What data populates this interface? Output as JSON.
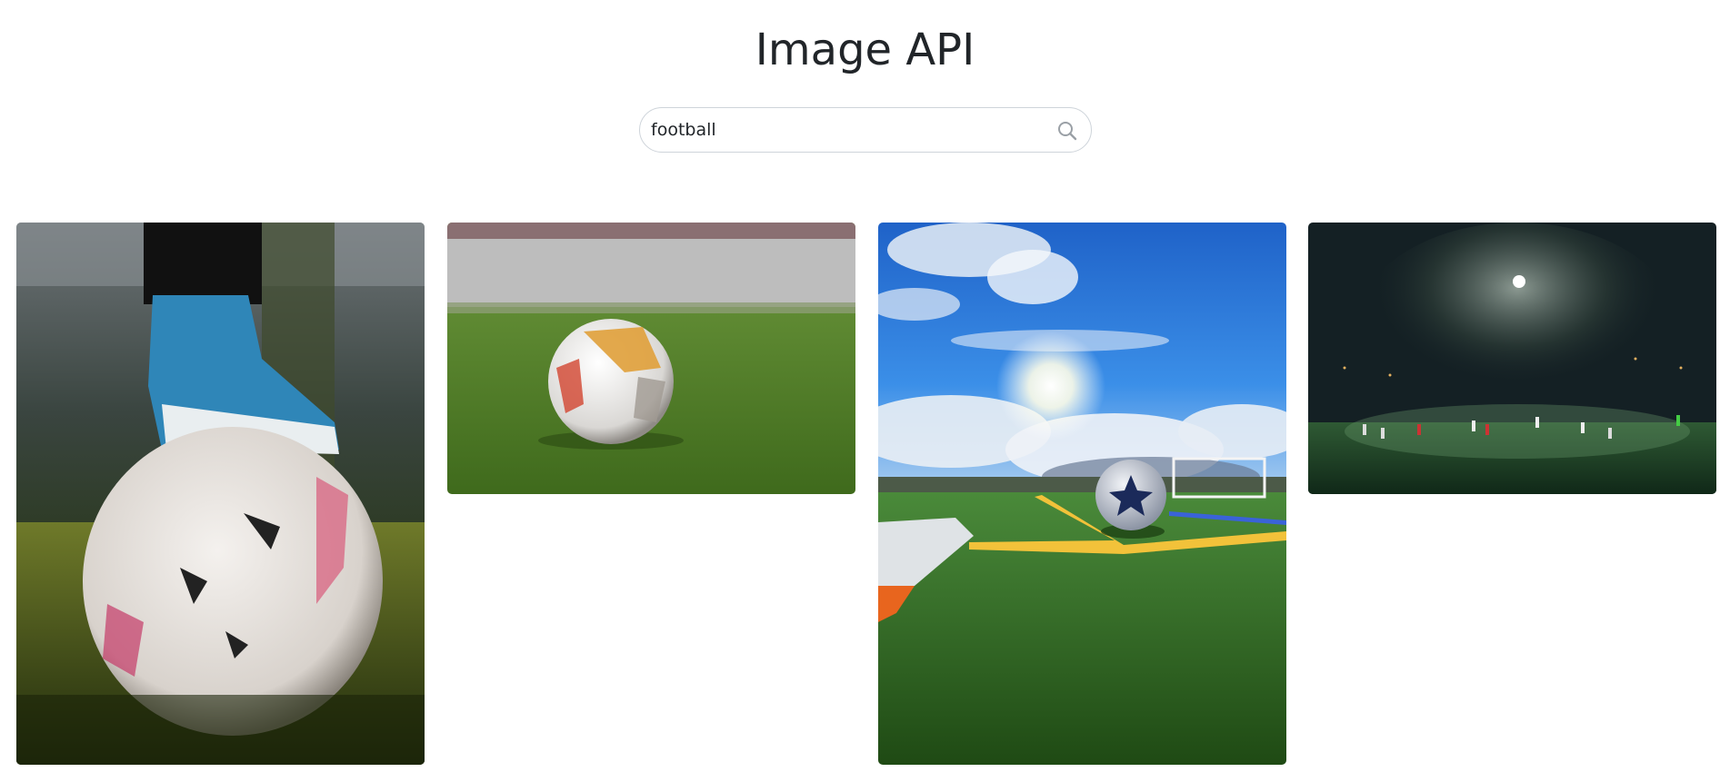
{
  "app": {
    "title": "Image API"
  },
  "search": {
    "value": "football",
    "icon": "search-icon"
  },
  "gallery": {
    "images": [
      {
        "name": "cleat-on-ball"
      },
      {
        "name": "ball-on-grass"
      },
      {
        "name": "ball-on-turf-under-sky"
      },
      {
        "name": "night-match-floodlight"
      }
    ]
  },
  "colors": {
    "text": "#212529",
    "border": "#ced4da",
    "icon": "#9aa0a6"
  }
}
